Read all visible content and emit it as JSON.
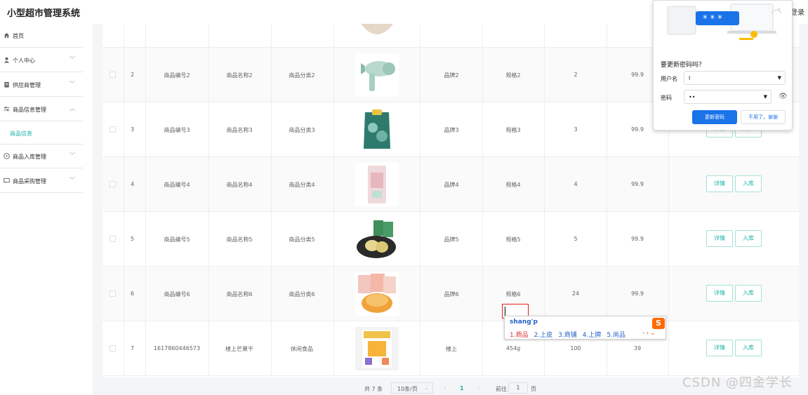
{
  "app": {
    "title": "小型超市管理系统",
    "login": "登录"
  },
  "sidebar": {
    "items": [
      {
        "label": "首页",
        "icon": "home-icon"
      },
      {
        "label": "个人中心",
        "icon": "user-icon"
      },
      {
        "label": "供应商管理",
        "icon": "clipboard-icon"
      },
      {
        "label": "商品信息管理",
        "icon": "sliders-icon"
      },
      {
        "label": "商品入库管理",
        "icon": "compass-icon"
      },
      {
        "label": "商品采购管理",
        "icon": "message-icon"
      }
    ],
    "active_sub": "商品信息"
  },
  "table": {
    "rows": [
      {
        "index": "2",
        "code": "商品编号2",
        "name": "商品名称2",
        "category": "商品分类2",
        "brand": "品牌2",
        "spec": "规格2",
        "qty": "2",
        "price": "99.9",
        "image": "hair-dryer"
      },
      {
        "index": "3",
        "code": "商品编号3",
        "name": "商品名称3",
        "category": "商品分类3",
        "brand": "品牌3",
        "spec": "规格3",
        "qty": "3",
        "price": "99.9",
        "image": "rice-bag"
      },
      {
        "index": "4",
        "code": "商品编号4",
        "name": "商品名称4",
        "category": "商品分类4",
        "brand": "品牌4",
        "spec": "规格4",
        "qty": "4",
        "price": "99.9",
        "image": "snack-pack"
      },
      {
        "index": "5",
        "code": "商品编号5",
        "name": "商品名称5",
        "category": "商品分类5",
        "brand": "品牌5",
        "spec": "规格5",
        "qty": "5",
        "price": "99.9",
        "image": "pastry-plate"
      },
      {
        "index": "6",
        "code": "商品编号6",
        "name": "商品名称6",
        "category": "商品分类6",
        "brand": "品牌6",
        "spec": "规格6",
        "qty": "24",
        "price": "99.9",
        "image": "chips-bowl"
      },
      {
        "index": "7",
        "code": "1617860446573",
        "name": "楼上芒果干",
        "category": "休闲食品",
        "brand": "楼上",
        "spec": "454g",
        "qty": "100",
        "price": "39",
        "image": "mango-pack"
      }
    ],
    "actions": {
      "detail": "详情",
      "stock_in": "入库"
    }
  },
  "pagination": {
    "total": "共 7 条",
    "page_size": "10条/页",
    "current": "1",
    "goto_prefix": "前往",
    "goto_value": "1",
    "goto_suffix": "页"
  },
  "password_popup": {
    "question": "要更新密码吗？",
    "username_label": "用户名",
    "username_value": "l",
    "password_label": "密码",
    "password_value": "••",
    "stars": "* * *",
    "update_button": "更新密码",
    "dismiss_button": "不用了，谢谢"
  },
  "ime": {
    "pinyin": "shang'p",
    "candidates": [
      "1.商品",
      "2.上皮",
      "3.商铺",
      "4.上牌",
      "5.尚品"
    ],
    "logo": "S"
  },
  "watermark": "CSDN @四金学长",
  "colors": {
    "accent": "#18b4a5",
    "chrome_blue": "#1a73e8",
    "ime_red": "#e0201a"
  }
}
